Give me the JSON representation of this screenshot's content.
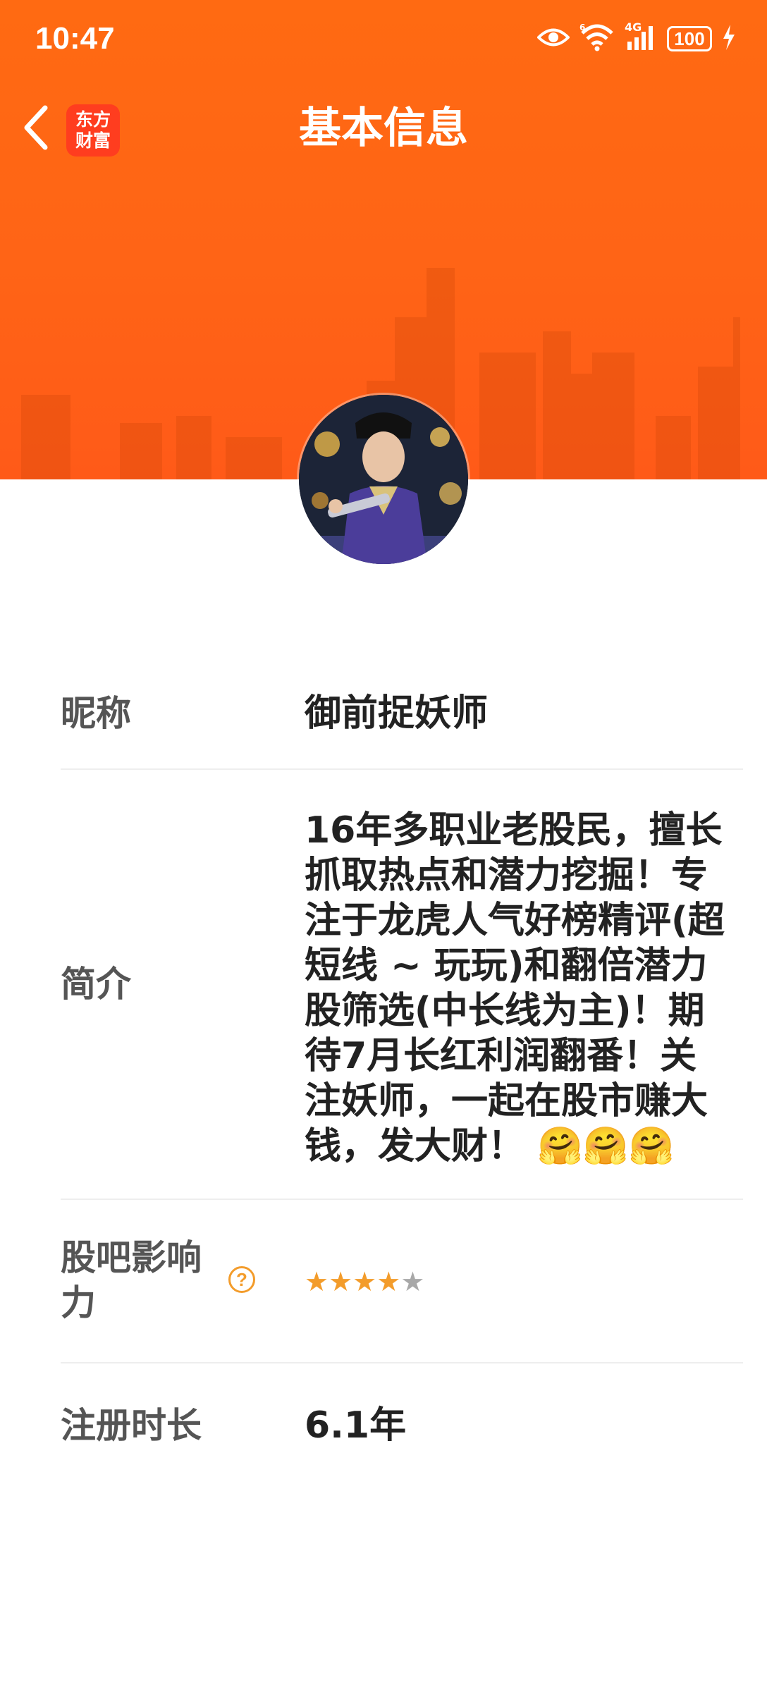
{
  "status_bar": {
    "time": "10:47",
    "battery": "100",
    "network_label": "4G",
    "wifi_label": "6"
  },
  "header": {
    "title": "基本信息",
    "app_logo_line1": "东方",
    "app_logo_line2": "财富",
    "accent_color": "#ff6a12"
  },
  "profile": {
    "nickname_label": "昵称",
    "nickname": "御前捉妖师",
    "bio_label": "简介",
    "bio": "16年多职业老股民，擅长抓取热点和潜力挖掘！专注于龙虎人气好榜精评(超短线 ~ 玩玩)和翻倍潜力股筛选(中长线为主)！期待7月长红利润翻番！关注妖师，一起在股市赚大钱，发大财！ 🤗🤗🤗",
    "influence_label": "股吧影响力",
    "influence_help_icon": "?",
    "influence_stars": 4,
    "influence_max_stars": 5,
    "star_on_color": "#f39c2b",
    "star_off_color": "#a8a8a8",
    "reg_label": "注册时长",
    "reg_value": "6.1年"
  }
}
